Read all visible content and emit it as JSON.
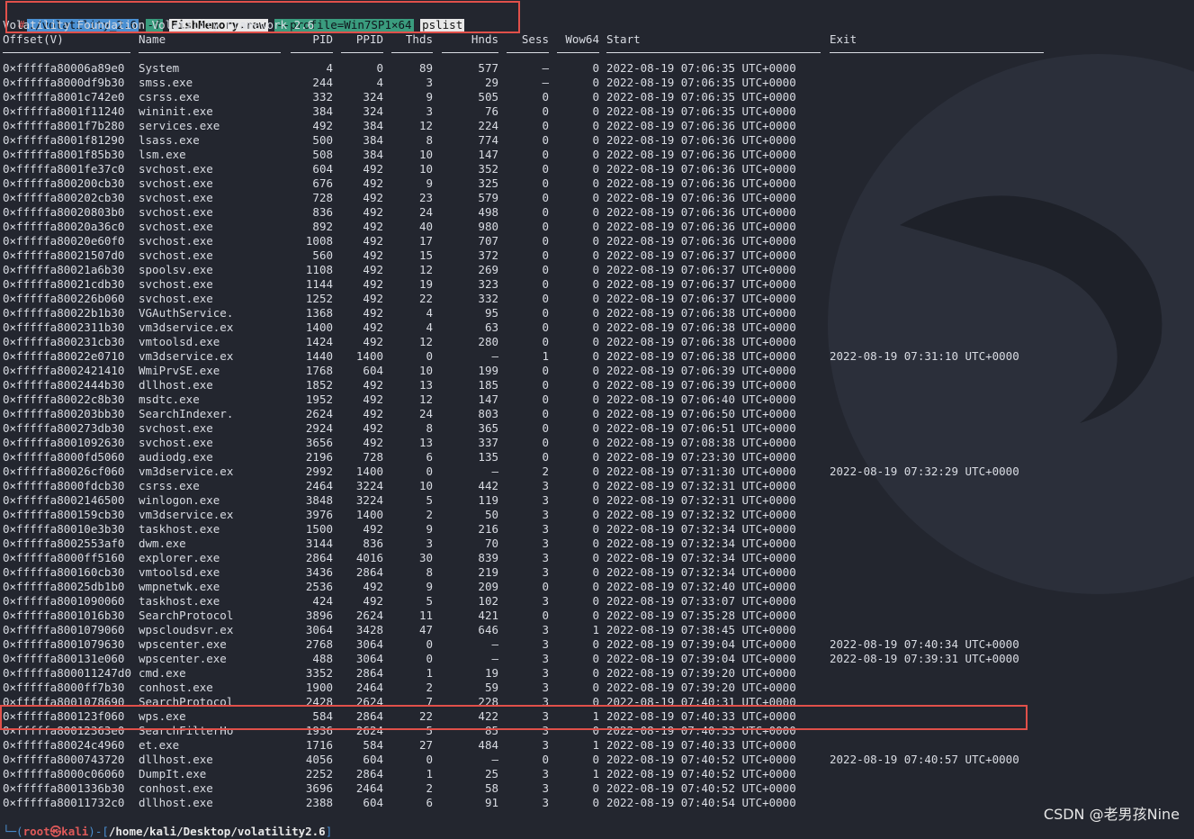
{
  "command": {
    "prompt": "#",
    "binary": "./volatility_2.6",
    "flag": "-f",
    "file": "FishMemory.raw",
    "profile": "--profile=Win7SP1×64",
    "plugin": "pslist"
  },
  "banner": "Volatility Foundation Volatility Framework 2.6",
  "headers": [
    "Offset(V)",
    "Name",
    "PID",
    "PPID",
    "Thds",
    "Hnds",
    "Sess",
    "Wow64",
    "Start",
    "Exit"
  ],
  "rows": [
    [
      "0×fffffa80006a89e0",
      "System",
      "4",
      "0",
      "89",
      "577",
      "—",
      "0",
      "2022-08-19 07:06:35 UTC+0000",
      ""
    ],
    [
      "0×fffffa8000df9b30",
      "smss.exe",
      "244",
      "4",
      "3",
      "29",
      "—",
      "0",
      "2022-08-19 07:06:35 UTC+0000",
      ""
    ],
    [
      "0×fffffa8001c742e0",
      "csrss.exe",
      "332",
      "324",
      "9",
      "505",
      "0",
      "0",
      "2022-08-19 07:06:35 UTC+0000",
      ""
    ],
    [
      "0×fffffa8001f11240",
      "wininit.exe",
      "384",
      "324",
      "3",
      "76",
      "0",
      "0",
      "2022-08-19 07:06:35 UTC+0000",
      ""
    ],
    [
      "0×fffffa8001f7b280",
      "services.exe",
      "492",
      "384",
      "12",
      "224",
      "0",
      "0",
      "2022-08-19 07:06:36 UTC+0000",
      ""
    ],
    [
      "0×fffffa8001f81290",
      "lsass.exe",
      "500",
      "384",
      "8",
      "774",
      "0",
      "0",
      "2022-08-19 07:06:36 UTC+0000",
      ""
    ],
    [
      "0×fffffa8001f85b30",
      "lsm.exe",
      "508",
      "384",
      "10",
      "147",
      "0",
      "0",
      "2022-08-19 07:06:36 UTC+0000",
      ""
    ],
    [
      "0×fffffa8001fe37c0",
      "svchost.exe",
      "604",
      "492",
      "10",
      "352",
      "0",
      "0",
      "2022-08-19 07:06:36 UTC+0000",
      ""
    ],
    [
      "0×fffffa800200cb30",
      "svchost.exe",
      "676",
      "492",
      "9",
      "325",
      "0",
      "0",
      "2022-08-19 07:06:36 UTC+0000",
      ""
    ],
    [
      "0×fffffa800202cb30",
      "svchost.exe",
      "728",
      "492",
      "23",
      "579",
      "0",
      "0",
      "2022-08-19 07:06:36 UTC+0000",
      ""
    ],
    [
      "0×fffffa80020803b0",
      "svchost.exe",
      "836",
      "492",
      "24",
      "498",
      "0",
      "0",
      "2022-08-19 07:06:36 UTC+0000",
      ""
    ],
    [
      "0×fffffa80020a36c0",
      "svchost.exe",
      "892",
      "492",
      "40",
      "980",
      "0",
      "0",
      "2022-08-19 07:06:36 UTC+0000",
      ""
    ],
    [
      "0×fffffa80020e60f0",
      "svchost.exe",
      "1008",
      "492",
      "17",
      "707",
      "0",
      "0",
      "2022-08-19 07:06:36 UTC+0000",
      ""
    ],
    [
      "0×fffffa80021507d0",
      "svchost.exe",
      "560",
      "492",
      "15",
      "372",
      "0",
      "0",
      "2022-08-19 07:06:37 UTC+0000",
      ""
    ],
    [
      "0×fffffa80021a6b30",
      "spoolsv.exe",
      "1108",
      "492",
      "12",
      "269",
      "0",
      "0",
      "2022-08-19 07:06:37 UTC+0000",
      ""
    ],
    [
      "0×fffffa80021cdb30",
      "svchost.exe",
      "1144",
      "492",
      "19",
      "323",
      "0",
      "0",
      "2022-08-19 07:06:37 UTC+0000",
      ""
    ],
    [
      "0×fffffa800226b060",
      "svchost.exe",
      "1252",
      "492",
      "22",
      "332",
      "0",
      "0",
      "2022-08-19 07:06:37 UTC+0000",
      ""
    ],
    [
      "0×fffffa80022b1b30",
      "VGAuthService.",
      "1368",
      "492",
      "4",
      "95",
      "0",
      "0",
      "2022-08-19 07:06:38 UTC+0000",
      ""
    ],
    [
      "0×fffffa8002311b30",
      "vm3dservice.ex",
      "1400",
      "492",
      "4",
      "63",
      "0",
      "0",
      "2022-08-19 07:06:38 UTC+0000",
      ""
    ],
    [
      "0×fffffa800231cb30",
      "vmtoolsd.exe",
      "1424",
      "492",
      "12",
      "280",
      "0",
      "0",
      "2022-08-19 07:06:38 UTC+0000",
      ""
    ],
    [
      "0×fffffa80022e0710",
      "vm3dservice.ex",
      "1440",
      "1400",
      "0",
      "—",
      "1",
      "0",
      "2022-08-19 07:06:38 UTC+0000",
      "2022-08-19 07:31:10 UTC+0000"
    ],
    [
      "0×fffffa8002421410",
      "WmiPrvSE.exe",
      "1768",
      "604",
      "10",
      "199",
      "0",
      "0",
      "2022-08-19 07:06:39 UTC+0000",
      ""
    ],
    [
      "0×fffffa8002444b30",
      "dllhost.exe",
      "1852",
      "492",
      "13",
      "185",
      "0",
      "0",
      "2022-08-19 07:06:39 UTC+0000",
      ""
    ],
    [
      "0×fffffa80022c8b30",
      "msdtc.exe",
      "1952",
      "492",
      "12",
      "147",
      "0",
      "0",
      "2022-08-19 07:06:40 UTC+0000",
      ""
    ],
    [
      "0×fffffa800203bb30",
      "SearchIndexer.",
      "2624",
      "492",
      "24",
      "803",
      "0",
      "0",
      "2022-08-19 07:06:50 UTC+0000",
      ""
    ],
    [
      "0×fffffa800273db30",
      "svchost.exe",
      "2924",
      "492",
      "8",
      "365",
      "0",
      "0",
      "2022-08-19 07:06:51 UTC+0000",
      ""
    ],
    [
      "0×fffffa8001092630",
      "svchost.exe",
      "3656",
      "492",
      "13",
      "337",
      "0",
      "0",
      "2022-08-19 07:08:38 UTC+0000",
      ""
    ],
    [
      "0×fffffa8000fd5060",
      "audiodg.exe",
      "2196",
      "728",
      "6",
      "135",
      "0",
      "0",
      "2022-08-19 07:23:30 UTC+0000",
      ""
    ],
    [
      "0×fffffa80026cf060",
      "vm3dservice.ex",
      "2992",
      "1400",
      "0",
      "—",
      "2",
      "0",
      "2022-08-19 07:31:30 UTC+0000",
      "2022-08-19 07:32:29 UTC+0000"
    ],
    [
      "0×fffffa8000fdcb30",
      "csrss.exe",
      "2464",
      "3224",
      "10",
      "442",
      "3",
      "0",
      "2022-08-19 07:32:31 UTC+0000",
      ""
    ],
    [
      "0×fffffa8002146500",
      "winlogon.exe",
      "3848",
      "3224",
      "5",
      "119",
      "3",
      "0",
      "2022-08-19 07:32:31 UTC+0000",
      ""
    ],
    [
      "0×fffffa800159cb30",
      "vm3dservice.ex",
      "3976",
      "1400",
      "2",
      "50",
      "3",
      "0",
      "2022-08-19 07:32:32 UTC+0000",
      ""
    ],
    [
      "0×fffffa80010e3b30",
      "taskhost.exe",
      "1500",
      "492",
      "9",
      "216",
      "3",
      "0",
      "2022-08-19 07:32:34 UTC+0000",
      ""
    ],
    [
      "0×fffffa8002553af0",
      "dwm.exe",
      "3144",
      "836",
      "3",
      "70",
      "3",
      "0",
      "2022-08-19 07:32:34 UTC+0000",
      ""
    ],
    [
      "0×fffffa8000ff5160",
      "explorer.exe",
      "2864",
      "4016",
      "30",
      "839",
      "3",
      "0",
      "2022-08-19 07:32:34 UTC+0000",
      ""
    ],
    [
      "0×fffffa800160cb30",
      "vmtoolsd.exe",
      "3436",
      "2864",
      "8",
      "219",
      "3",
      "0",
      "2022-08-19 07:32:34 UTC+0000",
      ""
    ],
    [
      "0×fffffa80025db1b0",
      "wmpnetwk.exe",
      "2536",
      "492",
      "9",
      "209",
      "0",
      "0",
      "2022-08-19 07:32:40 UTC+0000",
      ""
    ],
    [
      "0×fffffa8001090060",
      "taskhost.exe",
      "424",
      "492",
      "5",
      "102",
      "3",
      "0",
      "2022-08-19 07:33:07 UTC+0000",
      ""
    ],
    [
      "0×fffffa8001016b30",
      "SearchProtocol",
      "3896",
      "2624",
      "11",
      "421",
      "0",
      "0",
      "2022-08-19 07:35:28 UTC+0000",
      ""
    ],
    [
      "0×fffffa8001079060",
      "wpscloudsvr.ex",
      "3064",
      "3428",
      "47",
      "646",
      "3",
      "1",
      "2022-08-19 07:38:45 UTC+0000",
      ""
    ],
    [
      "0×fffffa8001079630",
      "wpscenter.exe",
      "2768",
      "3064",
      "0",
      "—",
      "3",
      "0",
      "2022-08-19 07:39:04 UTC+0000",
      "2022-08-19 07:40:34 UTC+0000"
    ],
    [
      "0×fffffa800131e060",
      "wpscenter.exe",
      "488",
      "3064",
      "0",
      "—",
      "3",
      "0",
      "2022-08-19 07:39:04 UTC+0000",
      "2022-08-19 07:39:31 UTC+0000"
    ],
    [
      "0×fffffa800011247d0",
      "cmd.exe",
      "3352",
      "2864",
      "1",
      "19",
      "3",
      "0",
      "2022-08-19 07:39:20 UTC+0000",
      ""
    ],
    [
      "0×fffffa8000ff7b30",
      "conhost.exe",
      "1900",
      "2464",
      "2",
      "59",
      "3",
      "0",
      "2022-08-19 07:39:20 UTC+0000",
      ""
    ],
    [
      "0×fffffa8001078690",
      "SearchProtocol",
      "2428",
      "2624",
      "7",
      "228",
      "3",
      "0",
      "2022-08-19 07:40:31 UTC+0000",
      ""
    ],
    [
      "0×fffffa800123f060",
      "wps.exe",
      "584",
      "2864",
      "22",
      "422",
      "3",
      "1",
      "2022-08-19 07:40:33 UTC+0000",
      ""
    ],
    [
      "0×fffffa80012363e0",
      "SearchFilterHo",
      "1936",
      "2624",
      "5",
      "85",
      "3",
      "0",
      "2022-08-19 07:40:33 UTC+0000",
      ""
    ],
    [
      "0×fffffa80024c4960",
      "et.exe",
      "1716",
      "584",
      "27",
      "484",
      "3",
      "1",
      "2022-08-19 07:40:33 UTC+0000",
      ""
    ],
    [
      "0×fffffa8000743720",
      "dllhost.exe",
      "4056",
      "604",
      "0",
      "—",
      "0",
      "0",
      "2022-08-19 07:40:52 UTC+0000",
      "2022-08-19 07:40:57 UTC+0000"
    ],
    [
      "0×fffffa8000c06060",
      "DumpIt.exe",
      "2252",
      "2864",
      "1",
      "25",
      "3",
      "1",
      "2022-08-19 07:40:52 UTC+0000",
      ""
    ],
    [
      "0×fffffa8001336b30",
      "conhost.exe",
      "3696",
      "2464",
      "2",
      "58",
      "3",
      "0",
      "2022-08-19 07:40:52 UTC+0000",
      ""
    ],
    [
      "0×fffffa80011732c0",
      "dllhost.exe",
      "2388",
      "604",
      "6",
      "91",
      "3",
      "0",
      "2022-08-19 07:40:54 UTC+0000",
      ""
    ]
  ],
  "bottom_prompt": {
    "prefix": "└─(",
    "user": "root㉿kali",
    "sep": ")-[",
    "path": "/home/kali/Desktop/volatility2.6",
    "suffix": "]"
  },
  "watermark": "CSDN @老男孩Nine",
  "colors": {
    "background": "#23262f",
    "highlight": "#e0504a",
    "path_bg": "#4a8fd1",
    "flag_bg": "#3a9c7e"
  }
}
